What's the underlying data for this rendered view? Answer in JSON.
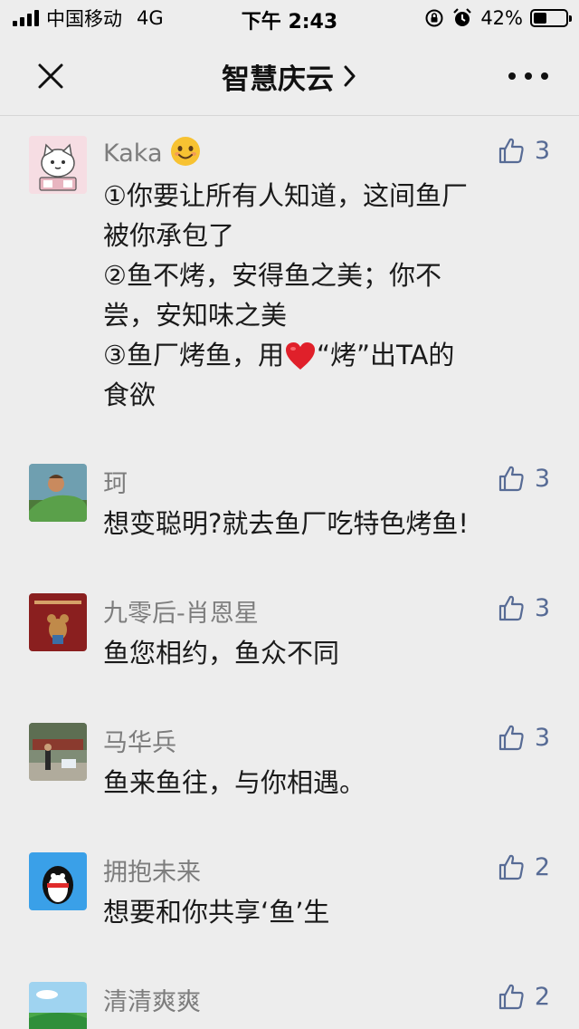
{
  "status_bar": {
    "carrier": "中国移动",
    "network": "4G",
    "time": "下午 2:43",
    "battery_percent": "42%",
    "battery_level": 0.42
  },
  "nav": {
    "title": "智慧庆云",
    "title_chevron": "›"
  },
  "comments": [
    {
      "name": "Kaka",
      "name_emoji": "smiling-face-emoji",
      "lines": [
        "①你要让所有人知道，这间鱼厂",
        "被你承包了",
        "②鱼不烤，安得鱼之美；你不",
        "尝，安知味之美"
      ],
      "line5_a": "③鱼厂烤鱼，用",
      "line5_emoji": "red-heart-emoji",
      "line5_b": "“烤”出TA的",
      "line6": "食欲",
      "likes": "3",
      "avatar": "cartoon-cat-avatar"
    },
    {
      "name": "珂",
      "text": "想变聪明?就去鱼厂吃特色烤鱼!",
      "likes": "3",
      "avatar": "dinosaur-boy-avatar"
    },
    {
      "name": "九零后-肖恩星",
      "text": "鱼您相约，鱼众不同",
      "likes": "3",
      "avatar": "mouse-card-avatar"
    },
    {
      "name": "马华兵",
      "text": "鱼来鱼往，与你相遇。",
      "likes": "3",
      "avatar": "outdoor-photo-avatar"
    },
    {
      "name": "拥抱未来",
      "text": "想要和你共享‘鱼’生",
      "likes": "2",
      "avatar": "penguin-avatar"
    },
    {
      "name": "清清爽爽",
      "likes": "2",
      "avatar": "landscape-avatar"
    }
  ],
  "colors": {
    "background": "#ededed",
    "like_blue": "#576b95",
    "name_gray": "#7d7d7d"
  }
}
